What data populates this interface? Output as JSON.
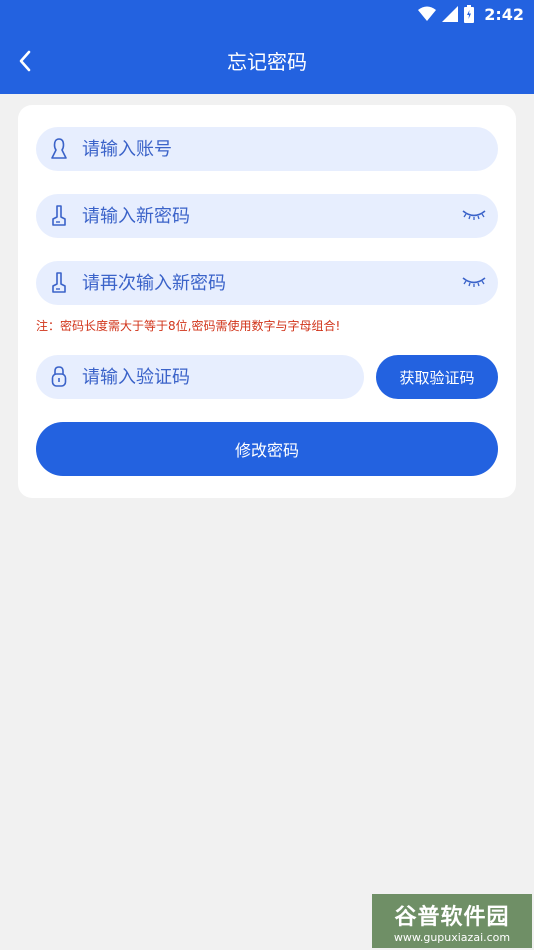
{
  "status_bar": {
    "time": "2:42"
  },
  "header": {
    "title": "忘记密码"
  },
  "form": {
    "account_placeholder": "请输入账号",
    "new_password_placeholder": "请输入新密码",
    "confirm_password_placeholder": "请再次输入新密码",
    "note": "注：密码长度需大于等于8位,密码需使用数字与字母组合!",
    "code_placeholder": "请输入验证码",
    "get_code_label": "获取验证码",
    "submit_label": "修改密码"
  },
  "watermark": {
    "logo": "谷普软件园",
    "url": "www.gupuxiazai.com"
  },
  "colors": {
    "primary": "#2362e0",
    "field_bg": "#e7eefe",
    "note": "#d1341a",
    "background": "#f1f1f1"
  }
}
